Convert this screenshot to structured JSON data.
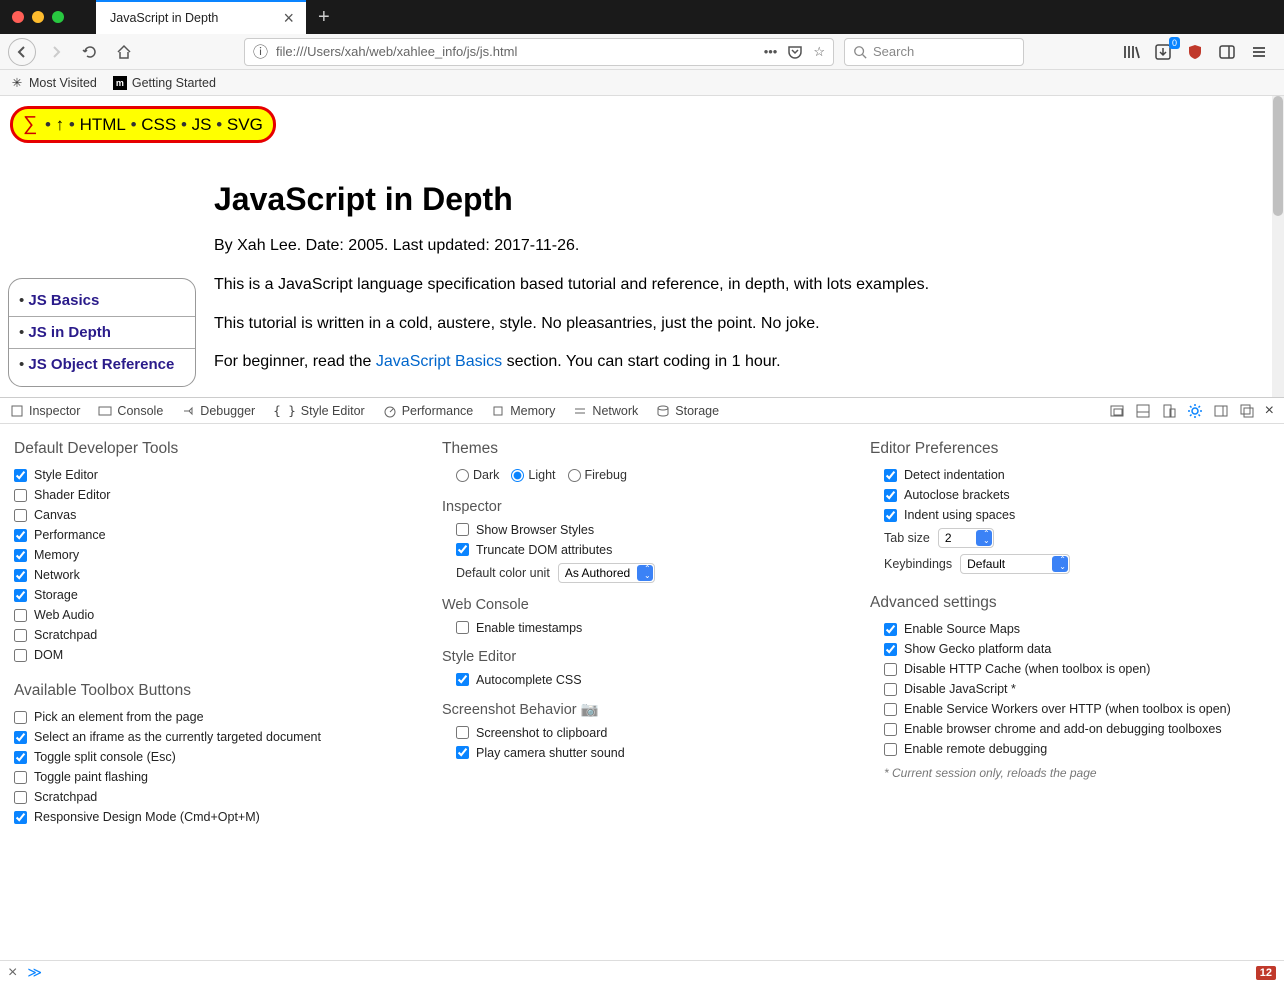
{
  "window": {
    "tab_title": "JavaScript in Depth"
  },
  "toolbar": {
    "url": "file:///Users/xah/web/xahlee_info/js/js.html",
    "search_placeholder": "Search"
  },
  "bookmarks": [
    {
      "label": "Most Visited"
    },
    {
      "label": "Getting Started"
    }
  ],
  "nav_pill": {
    "items": [
      "∑",
      "↑",
      "HTML",
      "CSS",
      "JS",
      "SVG"
    ]
  },
  "page": {
    "title": "JavaScript in Depth",
    "byline": "By Xah Lee. Date: 2005. Last updated: 2017-11-26.",
    "p1": "This is a JavaScript language specification based tutorial and reference, in depth, with lots examples.",
    "p2": "This tutorial is written in a cold, austere, style. No pleasantries, just the point. No joke.",
    "p3a": "For beginner, read the ",
    "p3link": "JavaScript Basics",
    "p3b": " section. You can start coding in 1 hour.",
    "h2": "JS in Depth"
  },
  "sidebar": [
    "JS Basics",
    "JS in Depth",
    "JS Object Reference"
  ],
  "devtools": {
    "tabs": [
      "Inspector",
      "Console",
      "Debugger",
      "Style Editor",
      "Performance",
      "Memory",
      "Network",
      "Storage"
    ],
    "col1": {
      "h1": "Default Developer Tools",
      "tools": [
        {
          "label": "Style Editor",
          "checked": true
        },
        {
          "label": "Shader Editor",
          "checked": false
        },
        {
          "label": "Canvas",
          "checked": false
        },
        {
          "label": "Performance",
          "checked": true
        },
        {
          "label": "Memory",
          "checked": true
        },
        {
          "label": "Network",
          "checked": true
        },
        {
          "label": "Storage",
          "checked": true
        },
        {
          "label": "Web Audio",
          "checked": false
        },
        {
          "label": "Scratchpad",
          "checked": false
        },
        {
          "label": "DOM",
          "checked": false
        }
      ],
      "h2": "Available Toolbox Buttons",
      "buttons": [
        {
          "label": "Pick an element from the page",
          "checked": false
        },
        {
          "label": "Select an iframe as the currently targeted document",
          "checked": true
        },
        {
          "label": "Toggle split console (Esc)",
          "checked": true
        },
        {
          "label": "Toggle paint flashing",
          "checked": false
        },
        {
          "label": "Scratchpad",
          "checked": false
        },
        {
          "label": "Responsive Design Mode (Cmd+Opt+M)",
          "checked": true
        }
      ]
    },
    "col2": {
      "themes_h": "Themes",
      "themes": [
        {
          "label": "Dark",
          "checked": false
        },
        {
          "label": "Light",
          "checked": true
        },
        {
          "label": "Firebug",
          "checked": false
        }
      ],
      "inspector_h": "Inspector",
      "inspector": [
        {
          "label": "Show Browser Styles",
          "checked": false
        },
        {
          "label": "Truncate DOM attributes",
          "checked": true
        }
      ],
      "color_label": "Default color unit",
      "color_value": "As Authored",
      "console_h": "Web Console",
      "console": [
        {
          "label": "Enable timestamps",
          "checked": false
        }
      ],
      "style_h": "Style Editor",
      "style": [
        {
          "label": "Autocomplete CSS",
          "checked": true
        }
      ],
      "screenshot_h": "Screenshot Behavior",
      "screenshot": [
        {
          "label": "Screenshot to clipboard",
          "checked": false
        },
        {
          "label": "Play camera shutter sound",
          "checked": true
        }
      ]
    },
    "col3": {
      "editor_h": "Editor Preferences",
      "editor": [
        {
          "label": "Detect indentation",
          "checked": true
        },
        {
          "label": "Autoclose brackets",
          "checked": true
        },
        {
          "label": "Indent using spaces",
          "checked": true
        }
      ],
      "tabsize_label": "Tab size",
      "tabsize_value": "2",
      "keybind_label": "Keybindings",
      "keybind_value": "Default",
      "advanced_h": "Advanced settings",
      "advanced": [
        {
          "label": "Enable Source Maps",
          "checked": true
        },
        {
          "label": "Show Gecko platform data",
          "checked": true
        },
        {
          "label": "Disable HTTP Cache (when toolbox is open)",
          "checked": false
        },
        {
          "label": "Disable JavaScript *",
          "checked": false
        },
        {
          "label": "Enable Service Workers over HTTP (when toolbox is open)",
          "checked": false
        },
        {
          "label": "Enable browser chrome and add-on debugging toolboxes",
          "checked": false
        },
        {
          "label": "Enable remote debugging",
          "checked": false
        }
      ],
      "note": "* Current session only, reloads the page"
    }
  },
  "console_err": "12"
}
